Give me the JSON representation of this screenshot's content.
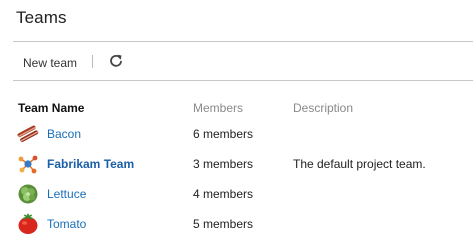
{
  "page": {
    "title": "Teams"
  },
  "toolbar": {
    "new_team_label": "New team",
    "refresh_icon": "refresh-icon"
  },
  "table": {
    "columns": [
      "Team Name",
      "Members",
      "Description"
    ],
    "rows": [
      {
        "name": "Bacon",
        "members": "6 members",
        "description": "",
        "icon": "bacon-icon",
        "is_default": false
      },
      {
        "name": "Fabrikam Team",
        "members": "3 members",
        "description": "The default project team.",
        "icon": "team-icon",
        "is_default": true
      },
      {
        "name": "Lettuce",
        "members": "4 members",
        "description": "",
        "icon": "lettuce-icon",
        "is_default": false
      },
      {
        "name": "Tomato",
        "members": "5 members",
        "description": "",
        "icon": "tomato-icon",
        "is_default": false
      }
    ]
  },
  "colors": {
    "link": "#1a6fba",
    "separator": "#c8c8c8",
    "header_muted": "#8a8a8a"
  }
}
